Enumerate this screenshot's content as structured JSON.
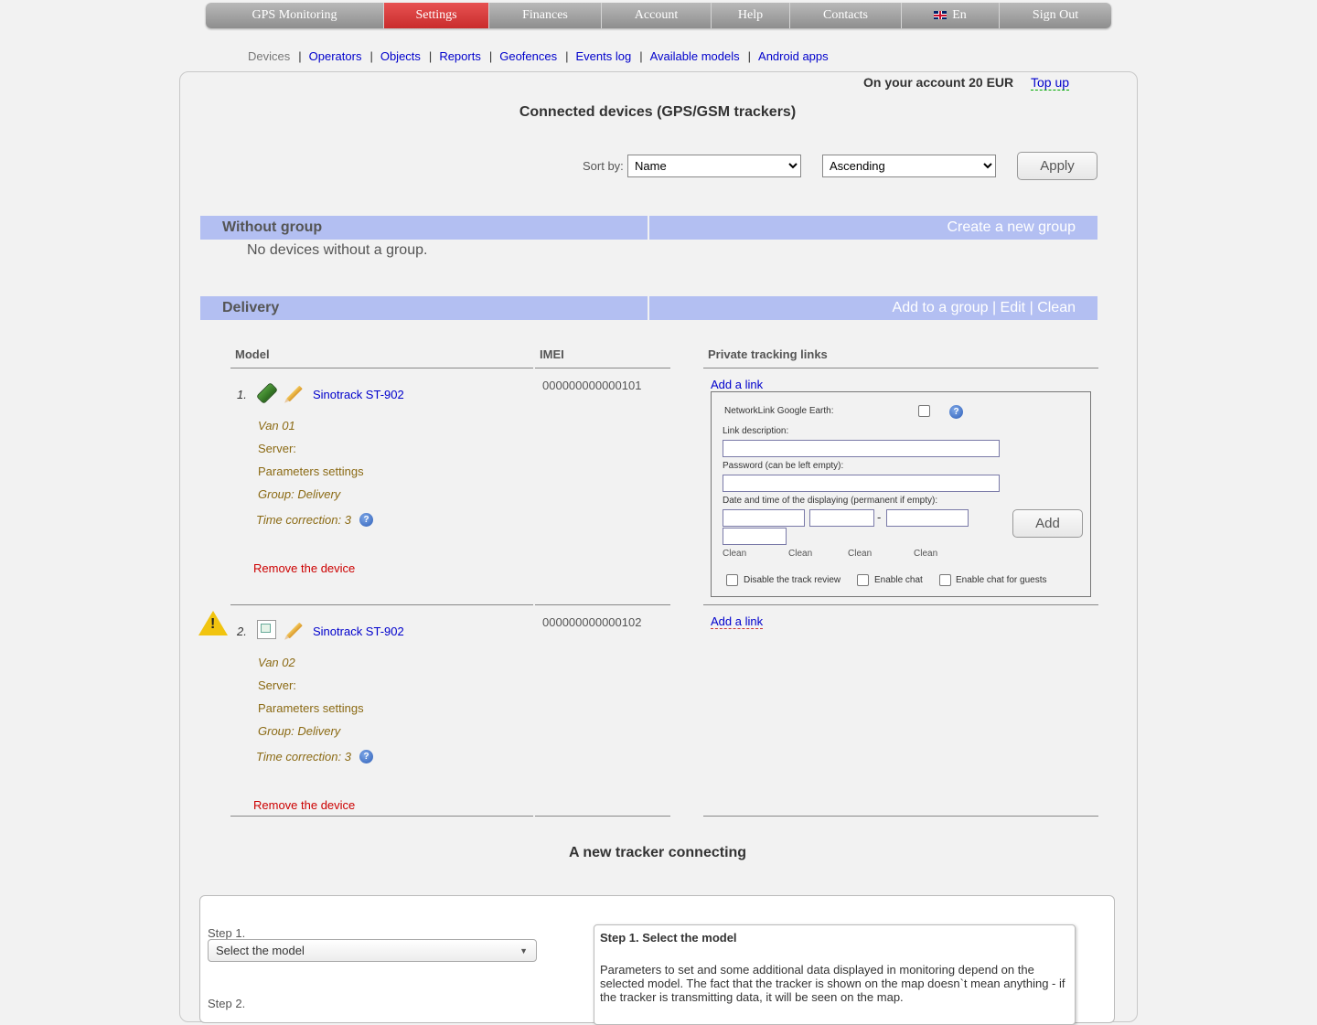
{
  "topnav": [
    {
      "label": "GPS Monitoring",
      "active": false
    },
    {
      "label": "Settings",
      "active": true
    },
    {
      "label": "Finances",
      "active": false
    },
    {
      "label": "Account",
      "active": false
    },
    {
      "label": "Help",
      "active": false
    },
    {
      "label": "Contacts",
      "active": false
    },
    {
      "label": "En",
      "active": false,
      "icon": "uk-flag-icon"
    },
    {
      "label": "Sign Out",
      "active": false
    }
  ],
  "subnav": [
    "Devices",
    "Operators",
    "Objects",
    "Reports",
    "Geofences",
    "Events log",
    "Available models",
    "Android apps"
  ],
  "account": {
    "balance_text": "On your account 20 EUR",
    "topup_label": "Top up"
  },
  "page_title": "Connected devices (GPS/GSM trackers)",
  "sort": {
    "label": "Sort by:",
    "field_value": "Name",
    "order_value": "Ascending",
    "apply_label": "Apply"
  },
  "groups": {
    "without": {
      "name": "Without group",
      "action": "Create a new group",
      "empty_text": "No devices without a group."
    },
    "delivery": {
      "name": "Delivery",
      "actions": [
        "Add to a group",
        "|",
        "Edit",
        "|",
        "Clean"
      ]
    }
  },
  "table": {
    "headers": {
      "model": "Model",
      "imei": "IMEI",
      "links": "Private tracking links"
    }
  },
  "devices": [
    {
      "num": "1.",
      "model": "Sinotrack ST-902",
      "name": "Van 01",
      "server": "Server:",
      "params": "Parameters settings",
      "group": "Group: Delivery",
      "time_correction": "Time correction: 3",
      "remove": "Remove the device",
      "imei": "000000000000101",
      "add_link": "Add a link"
    },
    {
      "num": "2.",
      "model": "Sinotrack ST-902",
      "name": "Van 02",
      "server": "Server:",
      "params": "Parameters settings",
      "group": "Group: Delivery",
      "time_correction": "Time correction: 3",
      "remove": "Remove the device",
      "imei": "000000000000102",
      "add_link": "Add a link"
    }
  ],
  "linkform": {
    "networklink_label": "NetworkLink Google Earth:",
    "desc_label": "Link description:",
    "password_label": "Password (can be left empty):",
    "date_label": "Date and time of the displaying (permanent if empty):",
    "date_sep": "-",
    "clean_labels": [
      "Clean",
      "Clean",
      "Clean",
      "Clean"
    ],
    "add_label": "Add",
    "options": [
      "Disable the track review",
      "Enable chat",
      "Enable chat for guests"
    ]
  },
  "new_tracker": {
    "title": "A new tracker connecting",
    "step1_label": "Step 1.",
    "step1_select": "Select the model",
    "step2_label": "Step 2.",
    "info_title": "Step 1. Select the model",
    "info_text": "Parameters to set and some additional data displayed in monitoring depend on the selected model. The fact that the tracker is shown on the map doesn`t mean anything - if the tracker is transmitting data, it will be seen on the map."
  }
}
